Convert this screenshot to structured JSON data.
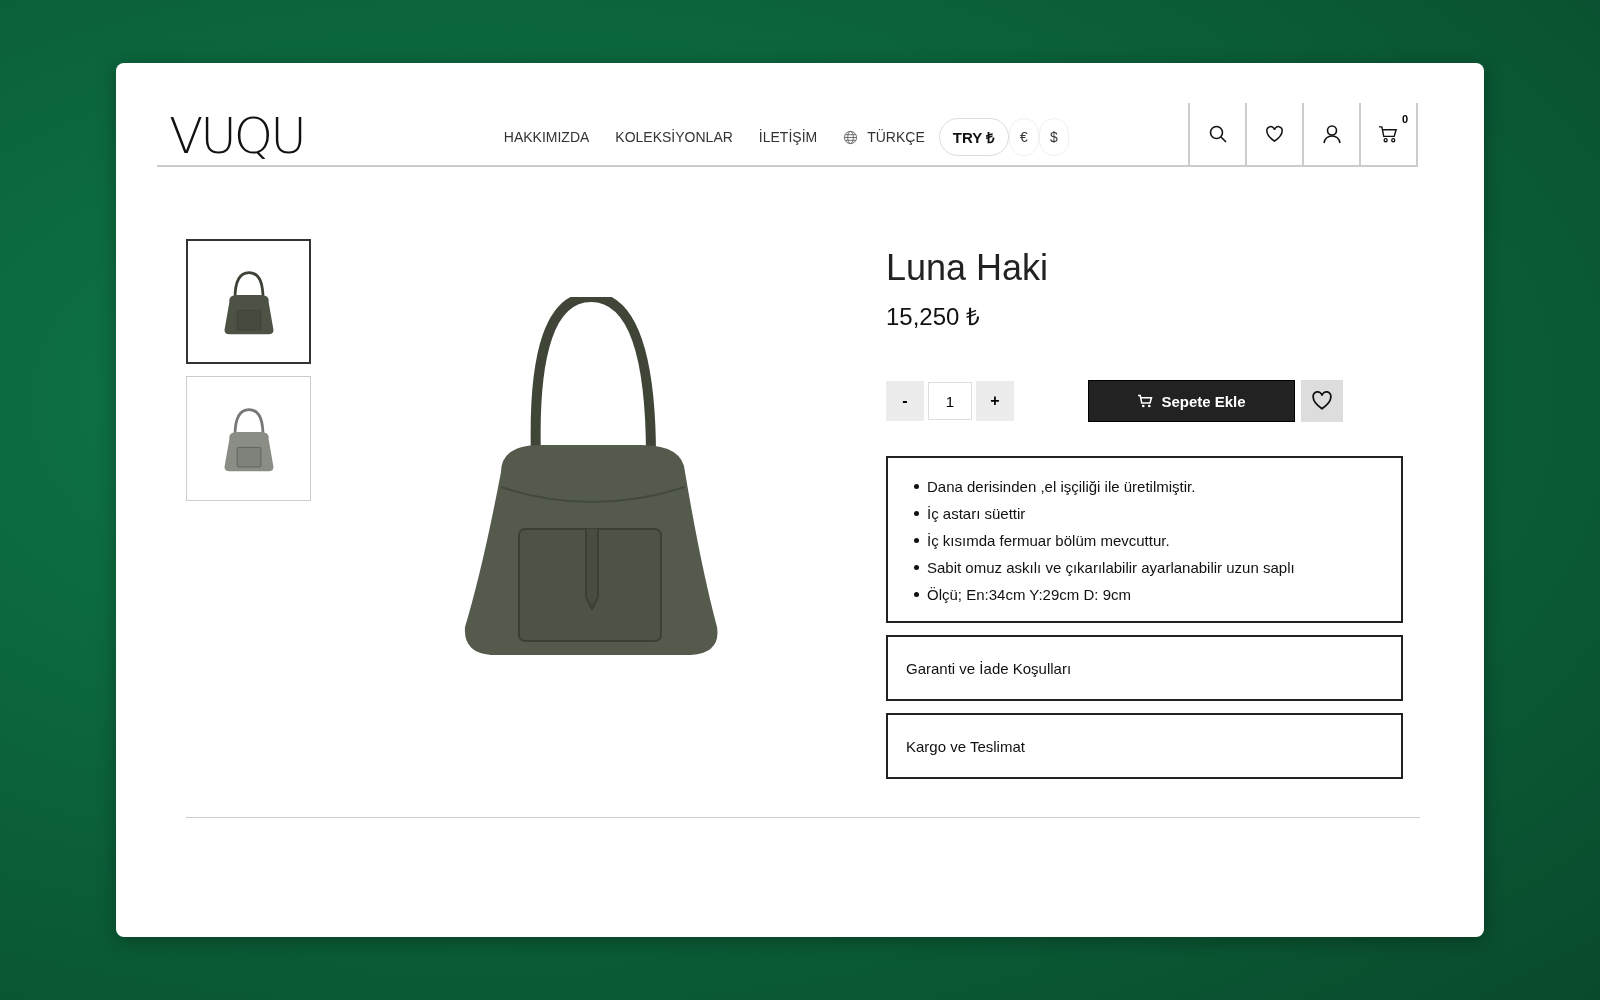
{
  "header": {
    "logo": "VUQU",
    "nav": [
      "HAKKIMIZDA",
      "KOLEKSİYONLAR",
      "İLETİŞİM"
    ],
    "language": "TÜRKÇE",
    "currencies": [
      {
        "label": "TRY ₺",
        "selected": true
      },
      {
        "label": "€",
        "selected": false
      },
      {
        "label": "$",
        "selected": false
      }
    ],
    "cart_count": "0"
  },
  "gallery": {
    "thumbnails": [
      {
        "selected": true
      },
      {
        "selected": false
      }
    ]
  },
  "product": {
    "title": "Luna Haki",
    "price": "15,250 ₺",
    "minus": "-",
    "quantity": "1",
    "plus": "+",
    "add_to_cart": "Sepete Ekle",
    "features": [
      "Dana derisinden ,el işçiliği ile üretilmiştir.",
      "İç astarı süettir",
      "İç kısımda fermuar bölüm mevcuttur.",
      "Sabit omuz askılı ve çıkarılabilir ayarlanabilir uzun saplı",
      "Ölçü; En:34cm  Y:29cm D: 9cm"
    ],
    "accordions": [
      "Garanti ve İade Koşulları",
      "Kargo ve Teslimat"
    ]
  }
}
